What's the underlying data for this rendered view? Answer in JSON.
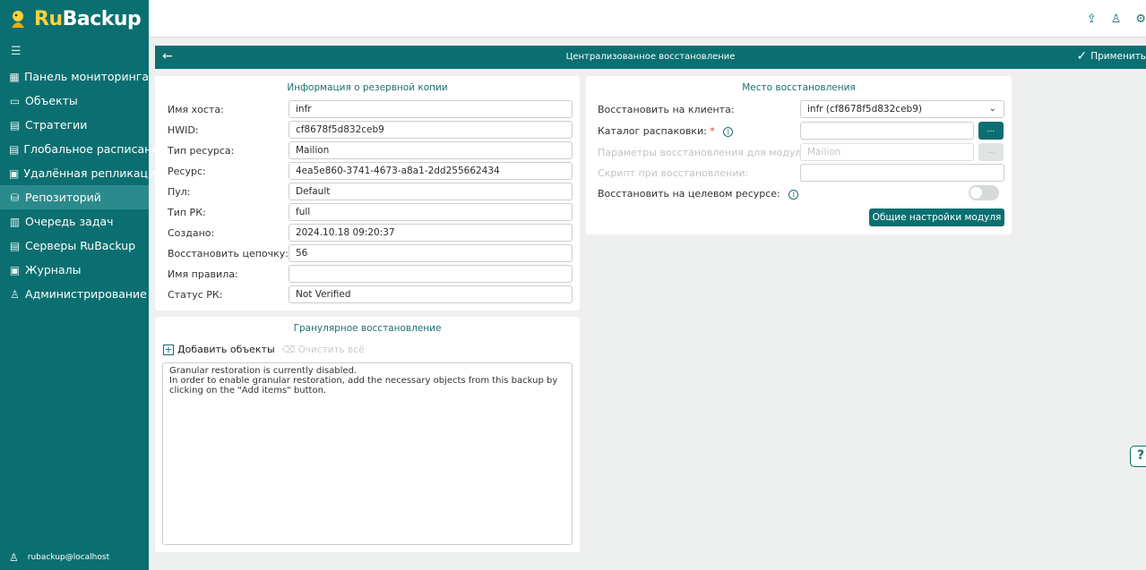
{
  "app": {
    "logo_ru": "Ru",
    "logo_backup": "Backup"
  },
  "sidebar": {
    "toggle_icon": "menu-collapse-icon",
    "items": [
      {
        "label": "Панель мониторинга",
        "icon": "dashboard-icon"
      },
      {
        "label": "Объекты",
        "icon": "monitor-icon"
      },
      {
        "label": "Стратегии",
        "icon": "document-icon"
      },
      {
        "label": "Глобальное расписание",
        "icon": "calendar-icon"
      },
      {
        "label": "Удалённая репликация",
        "icon": "replication-icon"
      },
      {
        "label": "Репозиторий",
        "icon": "database-icon",
        "active": true
      },
      {
        "label": "Очередь задач",
        "icon": "queue-icon"
      },
      {
        "label": "Серверы RuBackup",
        "icon": "server-icon"
      },
      {
        "label": "Журналы",
        "icon": "journal-icon"
      },
      {
        "label": "Администрирование",
        "icon": "admin-icon"
      }
    ],
    "user": "rubackup@localhost"
  },
  "header": {
    "title": "Централизованное восстановление",
    "apply_label": "Применить"
  },
  "backup_info": {
    "title": "Информация о резервной копии",
    "rows": [
      {
        "label": "Имя хоста:",
        "value": "infr"
      },
      {
        "label": "HWID:",
        "value": "cf8678f5d832ceb9"
      },
      {
        "label": "Тип ресурса:",
        "value": "Mailion"
      },
      {
        "label": "Ресурс:",
        "value": "4ea5e860-3741-4673-a8a1-2dd255662434"
      },
      {
        "label": "Пул:",
        "value": "Default"
      },
      {
        "label": "Тип РК:",
        "value": "full"
      },
      {
        "label": "Создано:",
        "value": "2024.10.18 09:20:37"
      },
      {
        "label": "Восстановить цепочку:",
        "value": "56"
      },
      {
        "label": "Имя правила:",
        "value": ""
      },
      {
        "label": "Статус РК:",
        "value": "Not Verified"
      }
    ]
  },
  "restore_location": {
    "title": "Место восстановления",
    "client_label": "Восстановить на клиента:",
    "client_value": "infr (cf8678f5d832ceb9)",
    "unpack_label": "Каталог распаковки:",
    "unpack_required": "*",
    "unpack_value": "",
    "module_params_label": "Параметры восстановления для модуля:",
    "module_params_value": "Mailion",
    "script_label": "Скрипт при восстановлении:",
    "script_value": "",
    "target_label": "Восстановить на целевом ресурсе:",
    "target_enabled": false,
    "browse_label": "...",
    "module_settings_label": "Общие настройки модуля"
  },
  "granular": {
    "title": "Гранулярное восстановление",
    "add_label": "Добавить объекты",
    "clear_label": "Очистить всё",
    "message_line1": "Granular restoration is currently disabled.",
    "message_line2": "In order to enable granular restoration, add the necessary objects from this backup by",
    "message_line3": "clicking on the \"Add items\" button."
  },
  "colors": {
    "primary": "#0b6f71",
    "accent_yellow": "#ffd23c",
    "active_nav": "#2b8a8c"
  }
}
